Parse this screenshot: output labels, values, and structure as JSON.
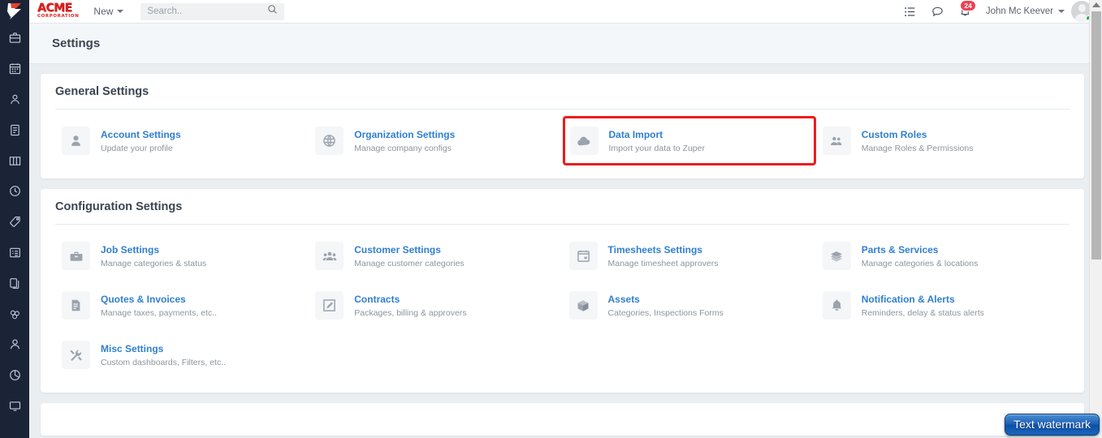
{
  "colors": {
    "rail_bg": "#1b2437",
    "accent_link": "#2f7fd0",
    "brand_red": "#e41f1f",
    "highlight_border": "#ee1c1c",
    "badge_red": "#ef4152",
    "status_green": "#21b24b",
    "page_bg": "#eaeef1"
  },
  "rail": {
    "logo_name": "zuper-logo-icon",
    "items": [
      {
        "icon": "briefcase-icon",
        "name": "rail-item-jobs"
      },
      {
        "icon": "calendar-icon",
        "name": "rail-item-schedule"
      },
      {
        "icon": "user-location-icon",
        "name": "rail-item-dispatch"
      },
      {
        "icon": "document-icon",
        "name": "rail-item-invoices"
      },
      {
        "icon": "columns-icon",
        "name": "rail-item-board"
      },
      {
        "icon": "clock-icon",
        "name": "rail-item-timesheets"
      },
      {
        "icon": "tag-icon",
        "name": "rail-item-quotes"
      },
      {
        "icon": "form-list-icon",
        "name": "rail-item-forms"
      },
      {
        "icon": "files-icon",
        "name": "rail-item-contracts"
      },
      {
        "icon": "parts-icon",
        "name": "rail-item-parts"
      },
      {
        "icon": "person-icon",
        "name": "rail-item-customers"
      },
      {
        "icon": "pie-chart-icon",
        "name": "rail-item-reports"
      },
      {
        "icon": "monitor-icon",
        "name": "rail-item-dashboard"
      }
    ]
  },
  "topbar": {
    "brand_top": "ACME",
    "brand_bottom": "CORPORATION",
    "new_button": "New",
    "search": {
      "value": "",
      "placeholder": "Search.."
    },
    "icons": [
      {
        "name": "list-view-icon"
      },
      {
        "name": "chat-bubble-icon"
      },
      {
        "name": "notifications-bell-icon",
        "badge": "24"
      }
    ],
    "user_name": "John Mc Keever"
  },
  "page": {
    "title": "Settings"
  },
  "sections": [
    {
      "name": "general-settings",
      "heading": "General Settings",
      "tiles": [
        {
          "icon": "person-icon",
          "label": "Account Settings",
          "sub": "Update your profile",
          "highlighted": false
        },
        {
          "icon": "globe-icon",
          "label": "Organization Settings",
          "sub": "Manage company configs",
          "highlighted": false
        },
        {
          "icon": "cloud-upload-icon",
          "label": "Data Import",
          "sub": "Import your data to Zuper",
          "highlighted": true
        },
        {
          "icon": "people-icon",
          "label": "Custom Roles",
          "sub": "Manage Roles & Permissions",
          "highlighted": false
        }
      ]
    },
    {
      "name": "configuration-settings",
      "heading": "Configuration Settings",
      "tiles": [
        {
          "icon": "briefcase-icon",
          "label": "Job Settings",
          "sub": "Manage categories & status",
          "highlighted": false
        },
        {
          "icon": "group-icon",
          "label": "Customer Settings",
          "sub": "Manage customer categories",
          "highlighted": false
        },
        {
          "icon": "calendar-card-icon",
          "label": "Timesheets Settings",
          "sub": "Manage timesheet approvers",
          "highlighted": false
        },
        {
          "icon": "layers-icon",
          "label": "Parts & Services",
          "sub": "Manage categories & locations",
          "highlighted": false
        },
        {
          "icon": "invoice-icon",
          "label": "Quotes & Invoices",
          "sub": "Manage taxes, payments, etc..",
          "highlighted": false
        },
        {
          "icon": "edit-square-icon",
          "label": "Contracts",
          "sub": "Packages, billing & approvers",
          "highlighted": false
        },
        {
          "icon": "cube-icon",
          "label": "Assets",
          "sub": "Categories, Inspections Forms",
          "highlighted": false
        },
        {
          "icon": "bell-icon",
          "label": "Notification & Alerts",
          "sub": "Reminders, delay & status alerts",
          "highlighted": false
        },
        {
          "icon": "wrench-icon",
          "label": "Misc Settings",
          "sub": "Custom dashboards, Filters, etc..",
          "highlighted": false
        }
      ]
    }
  ],
  "watermark": {
    "text": "Text watermark"
  },
  "scrollbar": {
    "name": "vertical-scrollbar"
  }
}
